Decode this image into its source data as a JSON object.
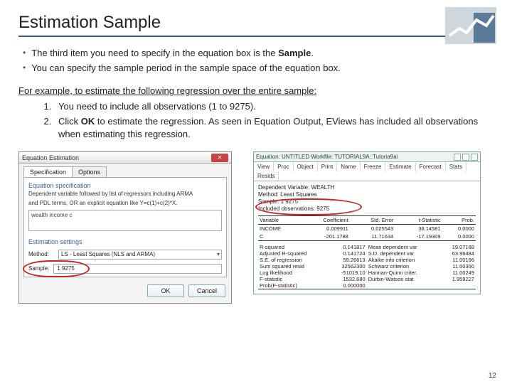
{
  "title": "Estimation Sample",
  "bullets": {
    "b1_pre": "The third item you need to specify in the equation box is the ",
    "b1_bold": "Sample",
    "b1_post": ".",
    "b2": "You can specify the sample period in the sample space of the equation box."
  },
  "example_line": "For example, to estimate the following regression over the entire sample:",
  "steps": {
    "s1": "You need to include all observations (1 to 9275).",
    "s2_pre": "Click ",
    "s2_bold": "OK",
    "s2_post": " to estimate the regression. As seen in Equation Output, EViews has included all observations when estimating this regression."
  },
  "dialog": {
    "title": "Equation Estimation",
    "tabs": {
      "spec": "Specification",
      "opt": "Options"
    },
    "group_label": "Equation specification",
    "hint1": "Dependent variable followed by list of regressors including ARMA",
    "hint2": "and PDL terms, OR an explicit equation like Y=c(1)+c(2)*X.",
    "equation_text": "wealth income c",
    "est_label": "Estimation settings",
    "method_lbl": "Method:",
    "method_val": "LS - Least Squares (NLS and ARMA)",
    "sample_lbl": "Sample:",
    "sample_val": "1 9275",
    "ok": "OK",
    "cancel": "Cancel"
  },
  "output": {
    "title": "Equation: UNTITLED   Workfile: TUTORIAL9A::Tutoria9a\\",
    "toolbar": [
      "View",
      "Proc",
      "Object",
      "Print",
      "Name",
      "Freeze",
      "Estimate",
      "Forecast",
      "Stats",
      "Resids"
    ],
    "dep": "Dependent Variable: WEALTH",
    "method": "Method: Least Squares",
    "sample": "Sample: 1 9275",
    "included": "Included observations: 9275",
    "head": [
      "Variable",
      "Coefficient",
      "Std. Error",
      "t-Statistic",
      "Prob."
    ],
    "rows": [
      [
        "INCOME",
        "0.009911",
        "0.025543",
        "38.14581",
        "0.0000"
      ],
      [
        "C",
        "-201.1788",
        "11.71634",
        "-17.19309",
        "0.0000"
      ]
    ],
    "stats": [
      [
        "R-squared",
        "0.141817",
        "Mean dependent var",
        "19.07188"
      ],
      [
        "Adjusted R-squared",
        "0.141724",
        "S.D. dependent var",
        "63.96484"
      ],
      [
        "S.E. of regression",
        "59.26613",
        "Akaike info criterion",
        "11.00196"
      ],
      [
        "Sum squared resid",
        "32562300",
        "Schwarz criterion",
        "11.00350"
      ],
      [
        "Log likelihood",
        "-51019.10",
        "Hannan-Quinn criter.",
        "11.00249"
      ],
      [
        "F-statistic",
        "1532.680",
        "Durbin-Watson stat",
        "1.959227"
      ],
      [
        "Prob(F-statistic)",
        "0.000000",
        "",
        ""
      ]
    ]
  },
  "page": "12"
}
